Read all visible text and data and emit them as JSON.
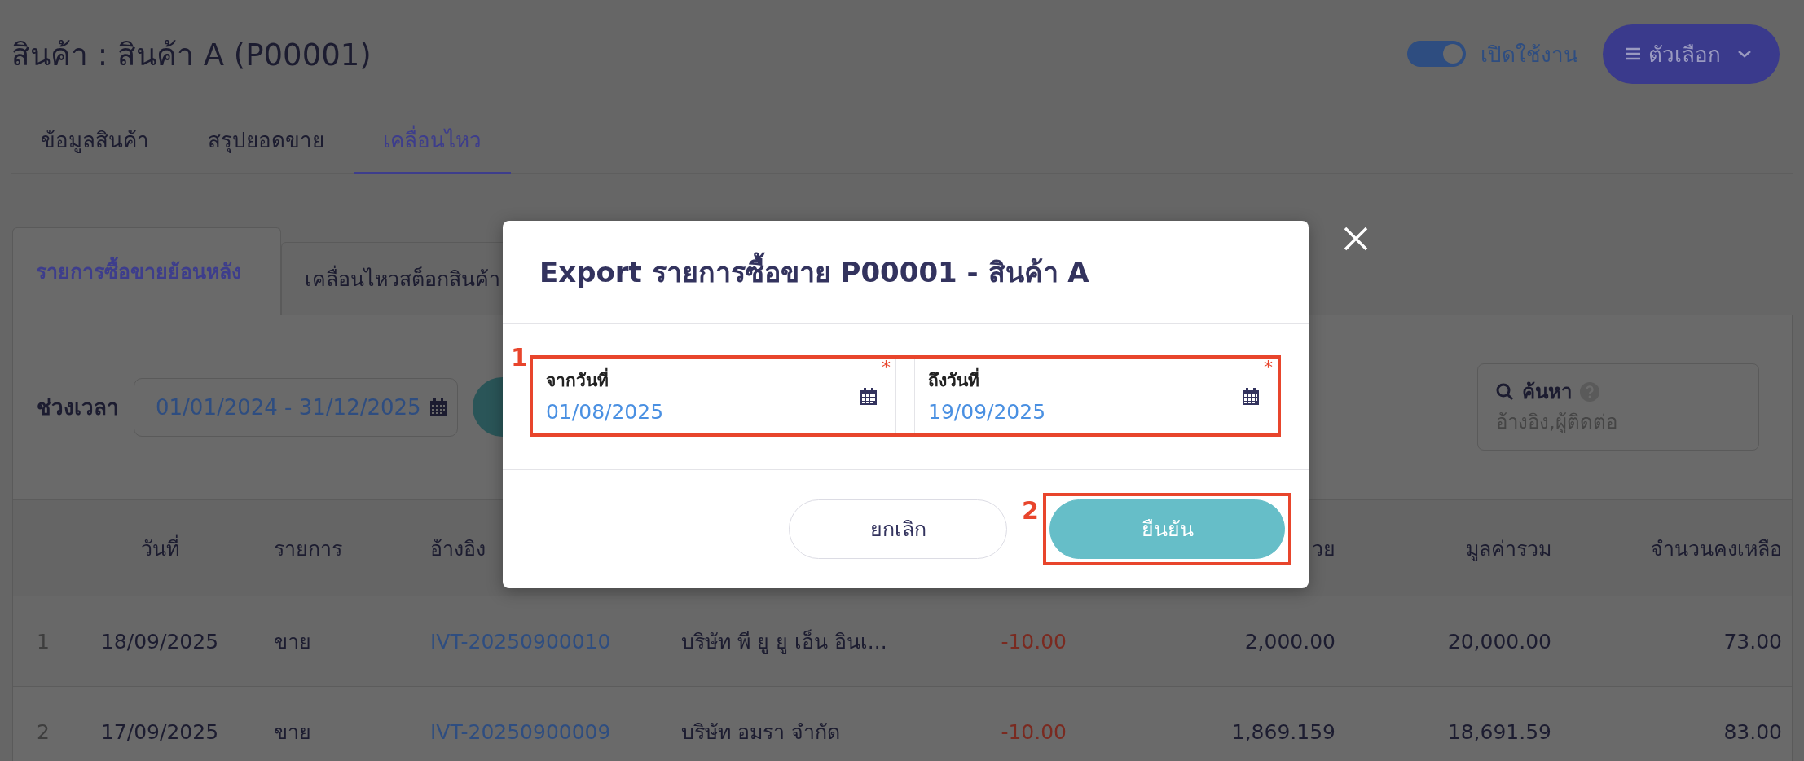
{
  "header": {
    "title": "สินค้า : สินค้า A (P00001)",
    "status_toggle": {
      "label": "เปิดใช้งาน",
      "on": true
    },
    "options_button": {
      "label": "ตัวเลือก"
    }
  },
  "tabs": [
    {
      "label": "ข้อมูลสินค้า",
      "selected": false
    },
    {
      "label": "สรุปยอดขาย",
      "selected": false
    },
    {
      "label": "เคลื่อนไหว",
      "selected": true
    }
  ],
  "sub_tabs": [
    {
      "label": "รายการซื้อขายย้อนหลัง",
      "selected": true
    },
    {
      "label": "เคลื่อนไหวสต็อกสินค้า",
      "selected": false
    }
  ],
  "filter": {
    "label": "ช่วงเวลา",
    "value": "01/01/2024 - 31/12/2025"
  },
  "search": {
    "label": "ค้นหา",
    "placeholder": "อ้างอิง,ผู้ติดต่อ"
  },
  "table": {
    "columns": [
      "วันที่",
      "รายการ",
      "อ้างอิง",
      "วย",
      "มูลค่ารวม",
      "จำนวนคงเหลือ"
    ],
    "rows": [
      {
        "number": "1",
        "date": "18/09/2025",
        "type": "ขาย",
        "reference": "IVT-20250900010",
        "contact": "บริษัท พี ยู ยู เอ็น อินเ...",
        "quantity": "-10.00",
        "unit_price": "2,000.00",
        "total": "20,000.00",
        "balance": "73.00"
      },
      {
        "number": "2",
        "date": "17/09/2025",
        "type": "ขาย",
        "reference": "IVT-20250900009",
        "contact": "บริษัท อมรา จำกัด",
        "quantity": "-10.00",
        "unit_price": "1,869.159",
        "total": "18,691.59",
        "balance": "83.00"
      }
    ]
  },
  "modal": {
    "title": "Export รายการซื้อขาย P00001 - สินค้า A",
    "fields": [
      {
        "label": "จากวันที่",
        "value": "01/08/2025",
        "required_mark": "*"
      },
      {
        "label": "ถึงวันที่",
        "value": "19/09/2025",
        "required_mark": "*"
      }
    ],
    "buttons": [
      {
        "label": "ยกเลิก",
        "kind": "secondary"
      },
      {
        "label": "ยืนยัน",
        "kind": "primary"
      }
    ]
  },
  "annotations": [
    {
      "label": "1"
    },
    {
      "label": "2"
    }
  ]
}
